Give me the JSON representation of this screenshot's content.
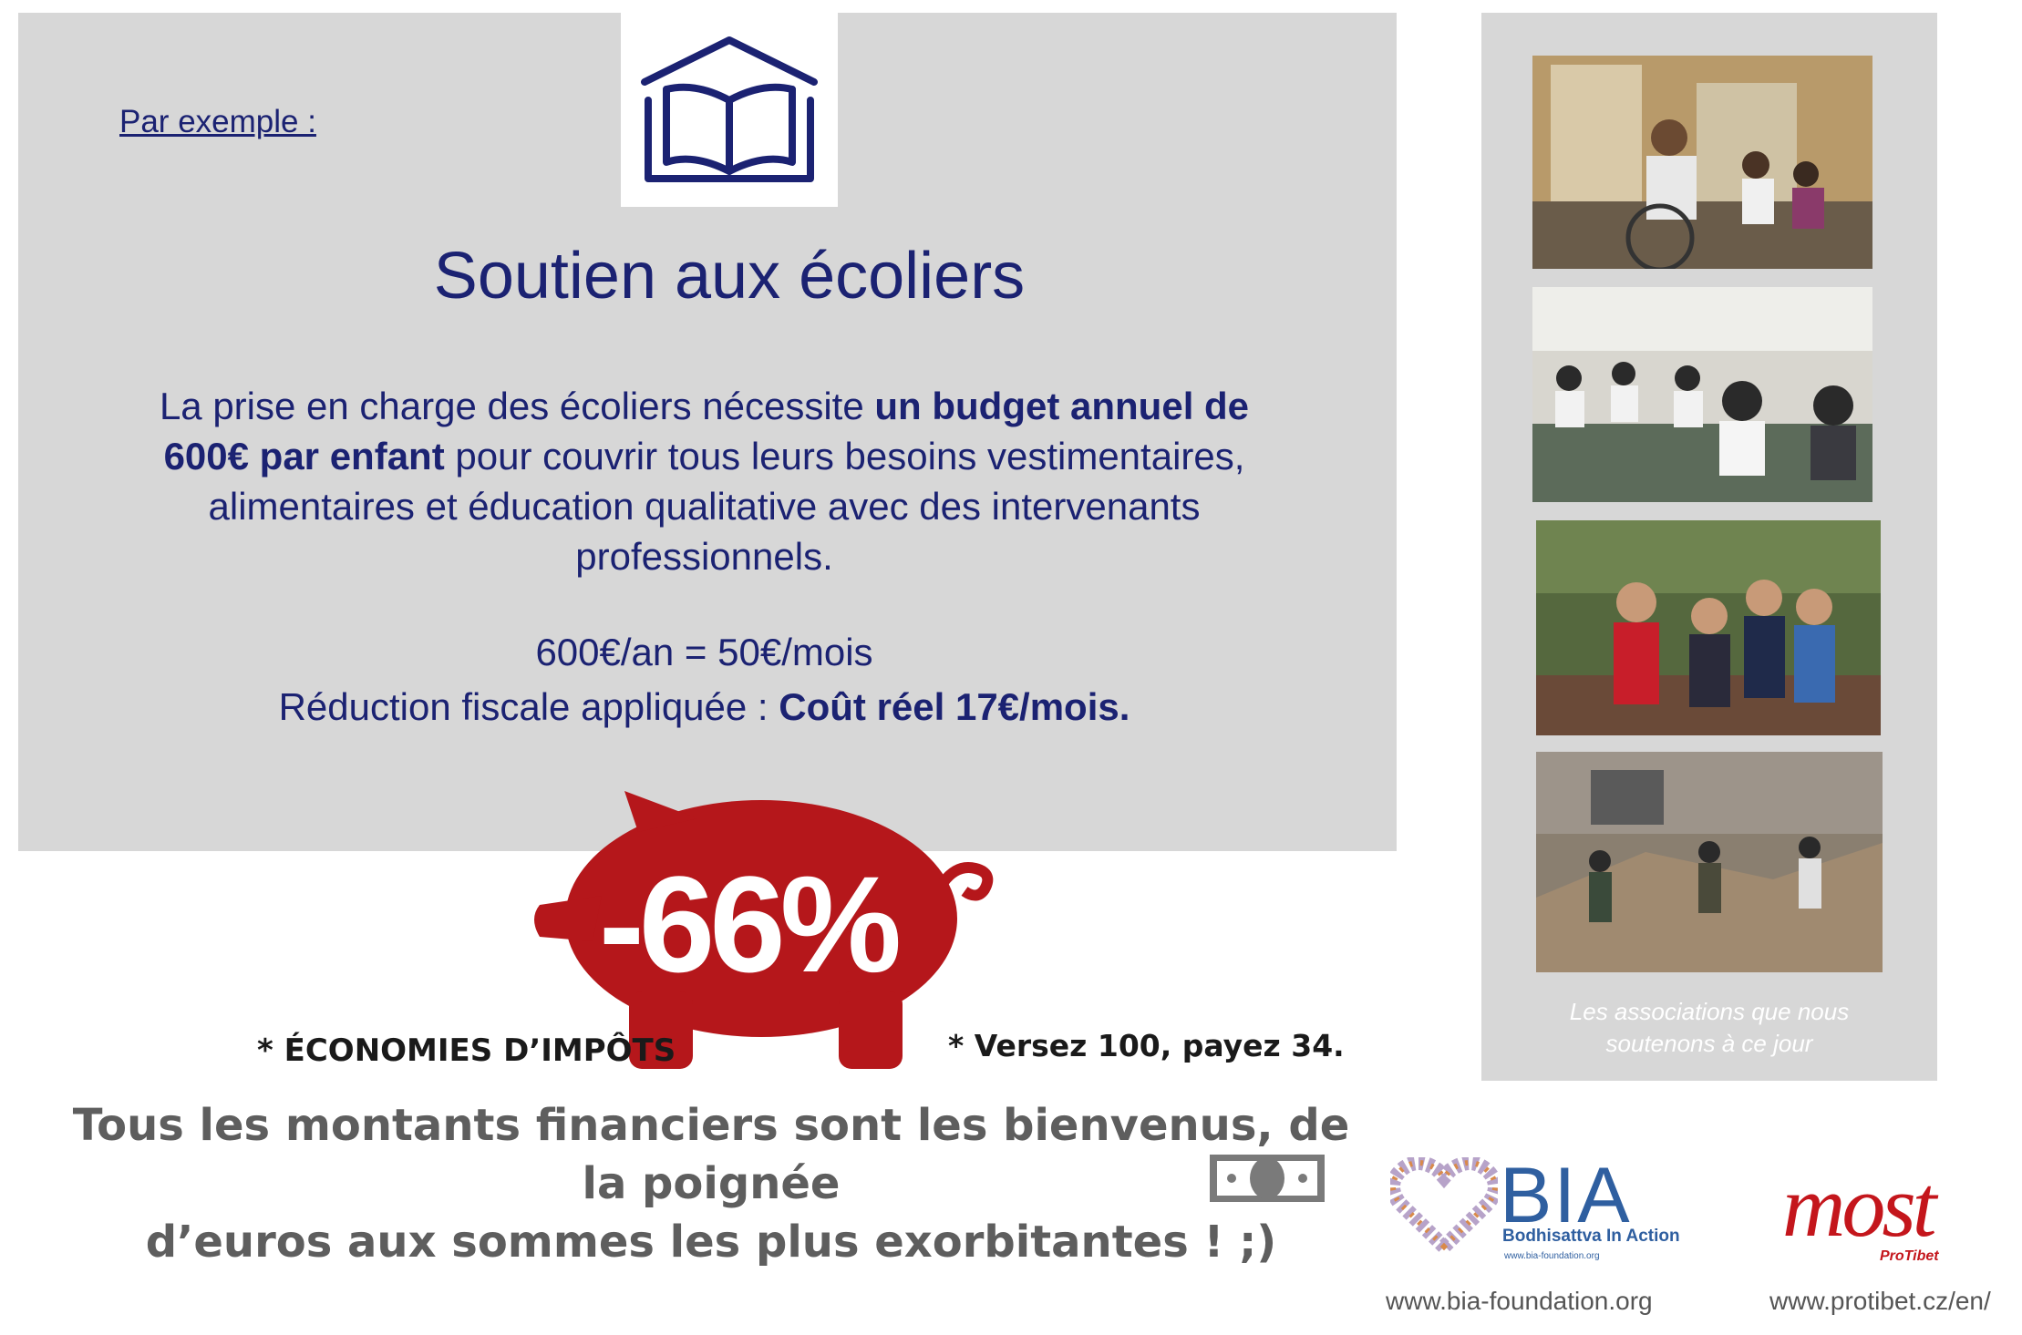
{
  "main": {
    "example_link": "Par exemple :",
    "title": "Soutien aux écoliers",
    "description": {
      "part1": "La prise en charge des écoliers nécessite ",
      "bold": "un budget annuel de 600€ par enfant",
      "part2": " pour couvrir tous leurs besoins vestimentaires, alimentaires et éducation qualitative avec des intervenants professionnels."
    },
    "price_line": "600€/an = 50€/mois",
    "reduction_prefix": "Réduction fiscale appliquée : ",
    "reduction_bold": "Coût réel 17€/mois."
  },
  "piggy": {
    "percent": "-66%",
    "tax_note": "* ÉCONOMIES D’IMPÔTS",
    "pay_note": "* Versez 100, payez 34."
  },
  "closing": {
    "line1": "Tous les montants financiers sont les bienvenus, de la poignée",
    "line2": "d’euros aux sommes les plus exorbitantes ! ;)"
  },
  "side": {
    "caption_line1": "Les associations que nous",
    "caption_line2": "soutenons à ce jour"
  },
  "logos": {
    "bia_name": "BIA",
    "bia_subtitle": "Bodhisattva In Action",
    "bia_small_url": "www.bia-foundation.org",
    "most_name": "most",
    "most_subtitle": "ProTibet",
    "bia_url": "www.bia-foundation.org",
    "most_url": "www.protibet.cz/en/"
  },
  "colors": {
    "navy": "#1b2272",
    "panel_grey": "#d7d7d7",
    "piggy_red": "#b5171b",
    "bia_blue": "#2f5fa0",
    "most_red": "#c4161c"
  },
  "icons": [
    "book-house-icon",
    "piggy-bank-icon",
    "money-bill-icon",
    "heart-logo-icon"
  ]
}
